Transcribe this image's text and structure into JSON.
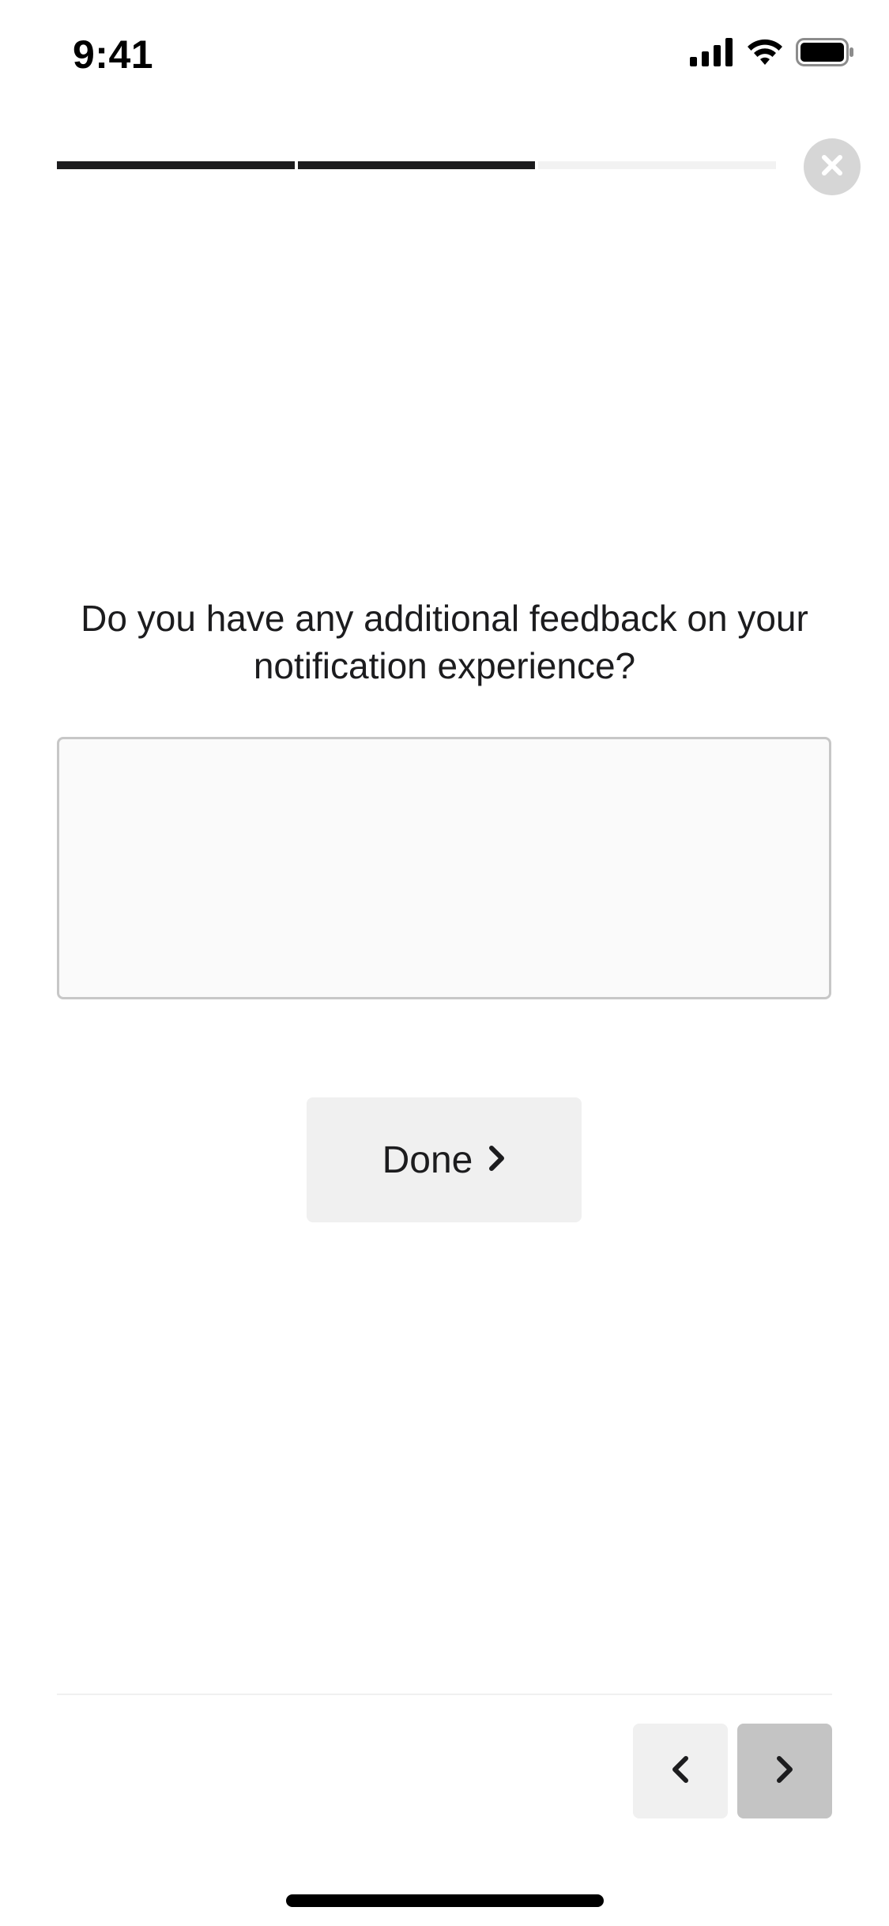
{
  "status_bar": {
    "time": "9:41",
    "icons": [
      "cellular-signal-icon",
      "wifi-icon",
      "battery-icon"
    ]
  },
  "progress": {
    "segments_total": 3,
    "segments_completed": 2,
    "fill_color": "#1c1c1e",
    "track_color": "#f2f2f2"
  },
  "close_icon": "close-icon",
  "question": {
    "text": "Do you have any additional feedback on your notification experience?"
  },
  "feedback_input": {
    "value": "",
    "placeholder": ""
  },
  "done_button": {
    "label": "Done",
    "icon": "chevron-right-icon"
  },
  "nav": {
    "prev_icon": "chevron-left-icon",
    "next_icon": "chevron-right-icon"
  }
}
